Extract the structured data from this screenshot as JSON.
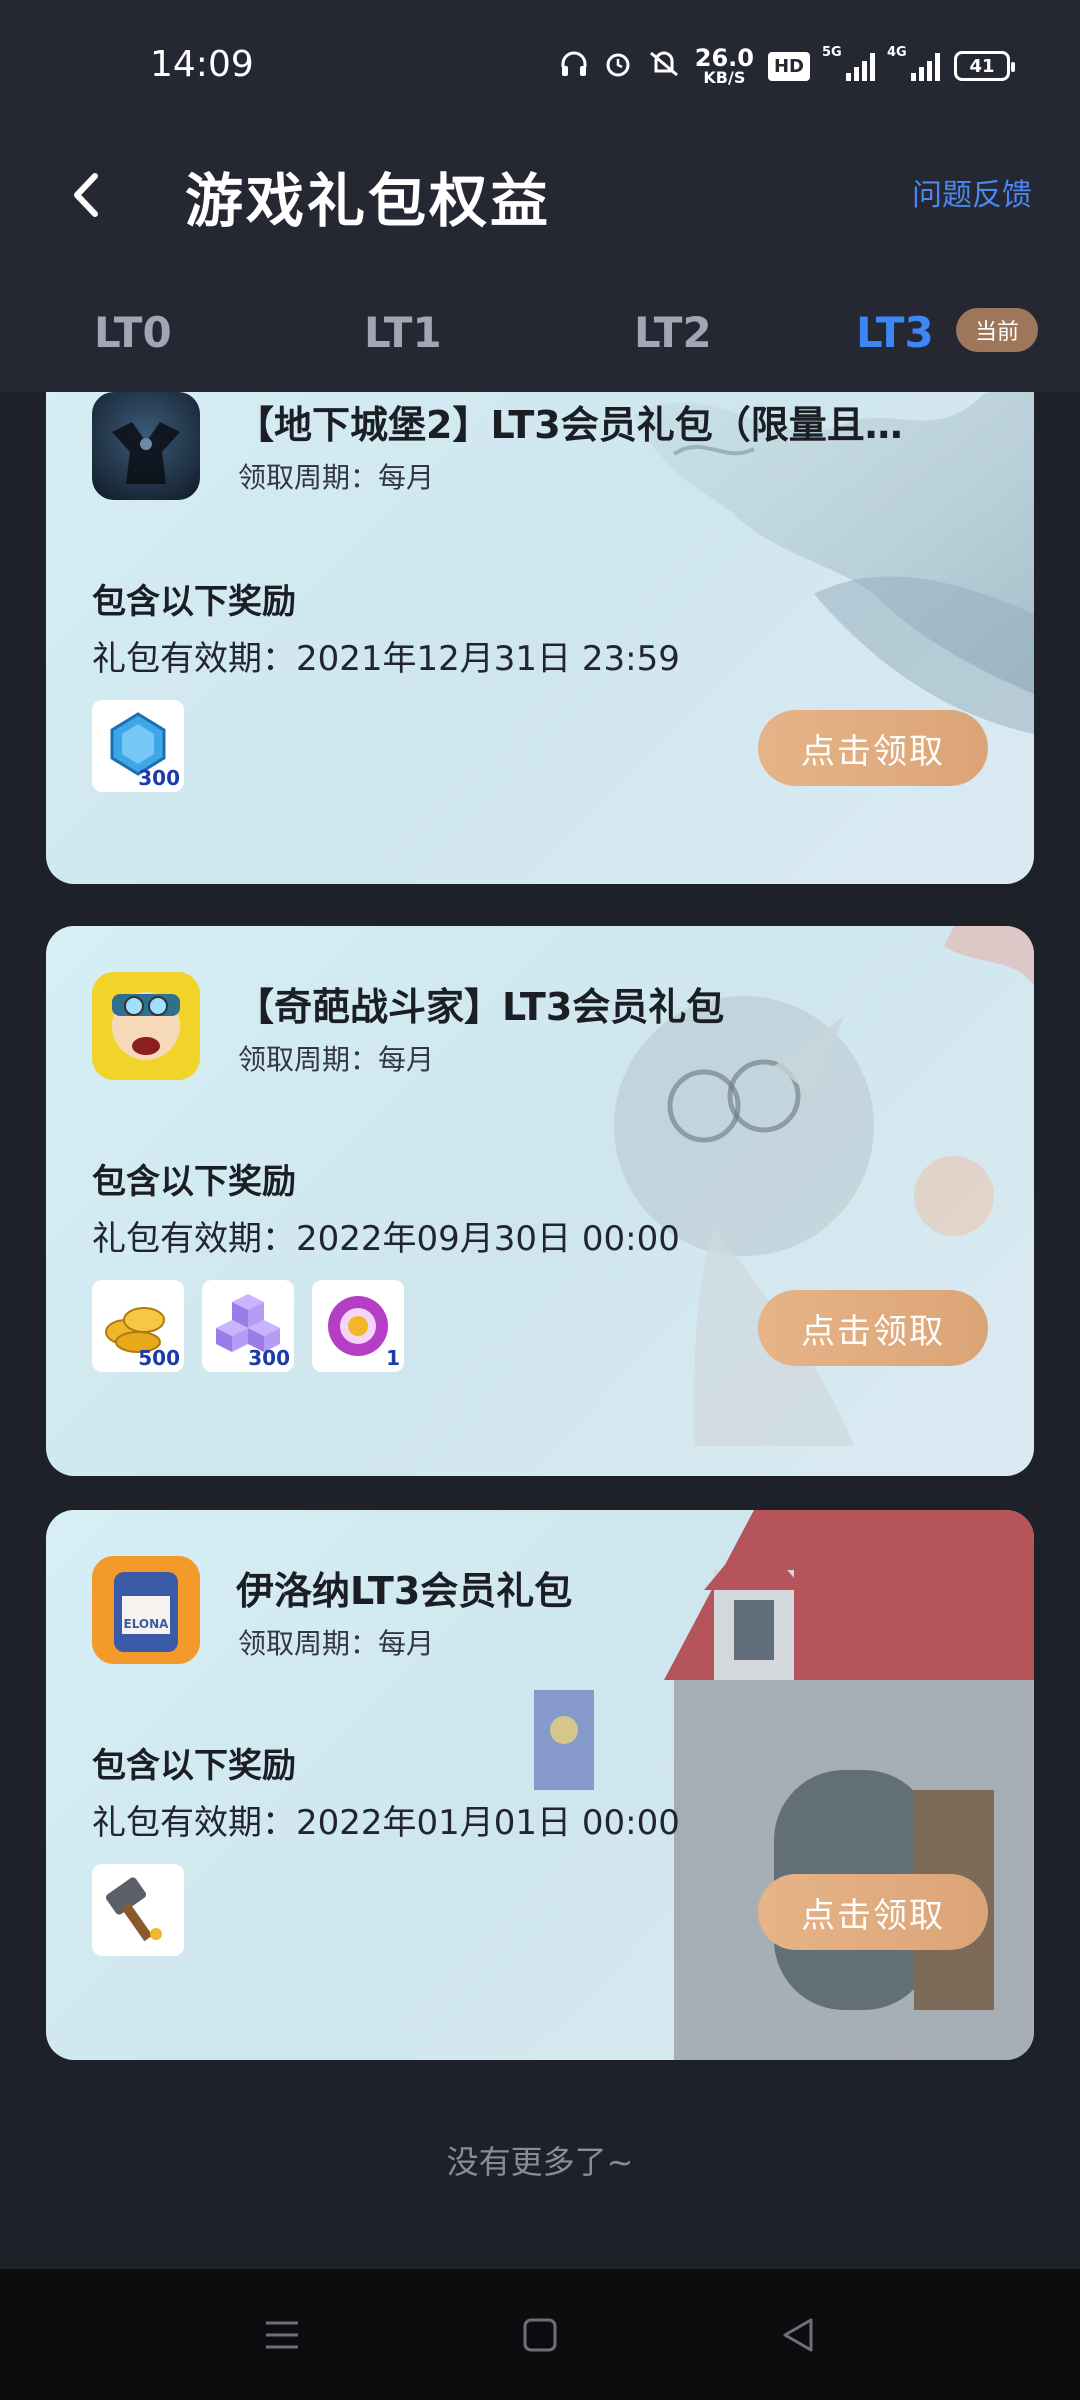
{
  "status_bar": {
    "time": "14:09",
    "speed_value": "26.0",
    "speed_unit": "KB/S",
    "hd": "HD",
    "net1": "5G",
    "net2": "4G",
    "battery": "41"
  },
  "header": {
    "title": "游戏礼包权益",
    "feedback": "问题反馈"
  },
  "tabs": [
    {
      "label": "LT0"
    },
    {
      "label": "LT1"
    },
    {
      "label": "LT2"
    },
    {
      "label": "LT3",
      "active": true
    }
  ],
  "current_badge": "当前",
  "cards": [
    {
      "title": "【地下城堡2】LT3会员礼包（限量且…",
      "cycle": "领取周期：每月",
      "rewards_label": "包含以下奖励",
      "validity": "礼包有效期：2021年12月31日 23:59",
      "rewards": [
        {
          "icon": "blue-gem-icon",
          "amount": "300"
        }
      ],
      "button": "点击领取"
    },
    {
      "title": "【奇葩战斗家】LT3会员礼包",
      "cycle": "领取周期：每月",
      "rewards_label": "包含以下奖励",
      "validity": "礼包有效期：2022年09月30日 00:00",
      "rewards": [
        {
          "icon": "gold-coins-icon",
          "amount": "500"
        },
        {
          "icon": "purple-cubes-icon",
          "amount": "300"
        },
        {
          "icon": "purple-ring-icon",
          "amount": "1"
        }
      ],
      "button": "点击领取"
    },
    {
      "title": "伊洛纳LT3会员礼包",
      "cycle": "领取周期：每月",
      "rewards_label": "包含以下奖励",
      "validity": "礼包有效期：2022年01月01日 00:00",
      "rewards": [
        {
          "icon": "hammer-icon",
          "amount": ""
        }
      ],
      "button": "点击领取"
    }
  ],
  "footer": "没有更多了~"
}
